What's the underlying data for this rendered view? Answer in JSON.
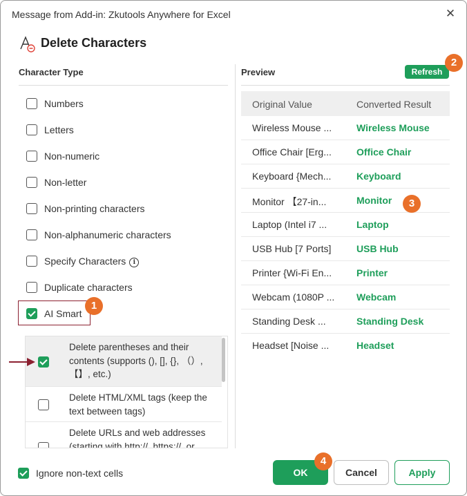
{
  "window": {
    "title": "Message from Add-in: Zkutools Anywhere for Excel",
    "close_glyph": "✕"
  },
  "header": {
    "title": "Delete Characters",
    "icon": "delete-characters-icon"
  },
  "character_type": {
    "title": "Character Type",
    "options": [
      {
        "label": "Numbers",
        "checked": false
      },
      {
        "label": "Letters",
        "checked": false
      },
      {
        "label": "Non-numeric",
        "checked": false
      },
      {
        "label": "Non-letter",
        "checked": false
      },
      {
        "label": "Non-printing characters",
        "checked": false
      },
      {
        "label": "Non-alphanumeric characters",
        "checked": false
      },
      {
        "label": "Specify Characters",
        "checked": false,
        "info": "i"
      },
      {
        "label": "Duplicate characters",
        "checked": false
      },
      {
        "label": "AI Smart",
        "checked": true
      }
    ],
    "ai_sub_options": [
      {
        "label": "Delete parentheses and their contents (supports (), [], {}, （）, 【】, etc.)",
        "checked": true
      },
      {
        "label": "Delete HTML/XML tags (keep the text between tags)",
        "checked": false
      },
      {
        "label": "Delete URLs and web addresses (starting with http://, https://, or",
        "checked": false
      }
    ]
  },
  "preview": {
    "title": "Preview",
    "refresh_label": "Refresh",
    "columns": [
      "Original Value",
      "Converted Result"
    ],
    "rows": [
      {
        "original": "Wireless Mouse ...",
        "converted": "Wireless Mouse"
      },
      {
        "original": "Office Chair [Erg...",
        "converted": "Office Chair"
      },
      {
        "original": "Keyboard {Mech...",
        "converted": "Keyboard"
      },
      {
        "original": "Monitor 【27-in...",
        "converted": "Monitor"
      },
      {
        "original": "Laptop (Intel i7 ...",
        "converted": "Laptop"
      },
      {
        "original": "USB Hub [7 Ports]",
        "converted": "USB Hub"
      },
      {
        "original": "Printer {Wi-Fi En...",
        "converted": "Printer"
      },
      {
        "original": "Webcam (1080P ...",
        "converted": "Webcam"
      },
      {
        "original": "Standing Desk ...",
        "converted": "Standing Desk"
      },
      {
        "original": "Headset [Noise ...",
        "converted": "Headset"
      }
    ]
  },
  "footer": {
    "ignore_label": "Ignore non-text cells",
    "ignore_checked": true,
    "ok_label": "OK",
    "cancel_label": "Cancel",
    "apply_label": "Apply"
  },
  "callouts": {
    "b1": "1",
    "b2": "2",
    "b3": "3",
    "b4": "4"
  },
  "colors": {
    "accent": "#1e9e5a",
    "badge": "#e9702a",
    "highlight_border": "#8b2030"
  }
}
